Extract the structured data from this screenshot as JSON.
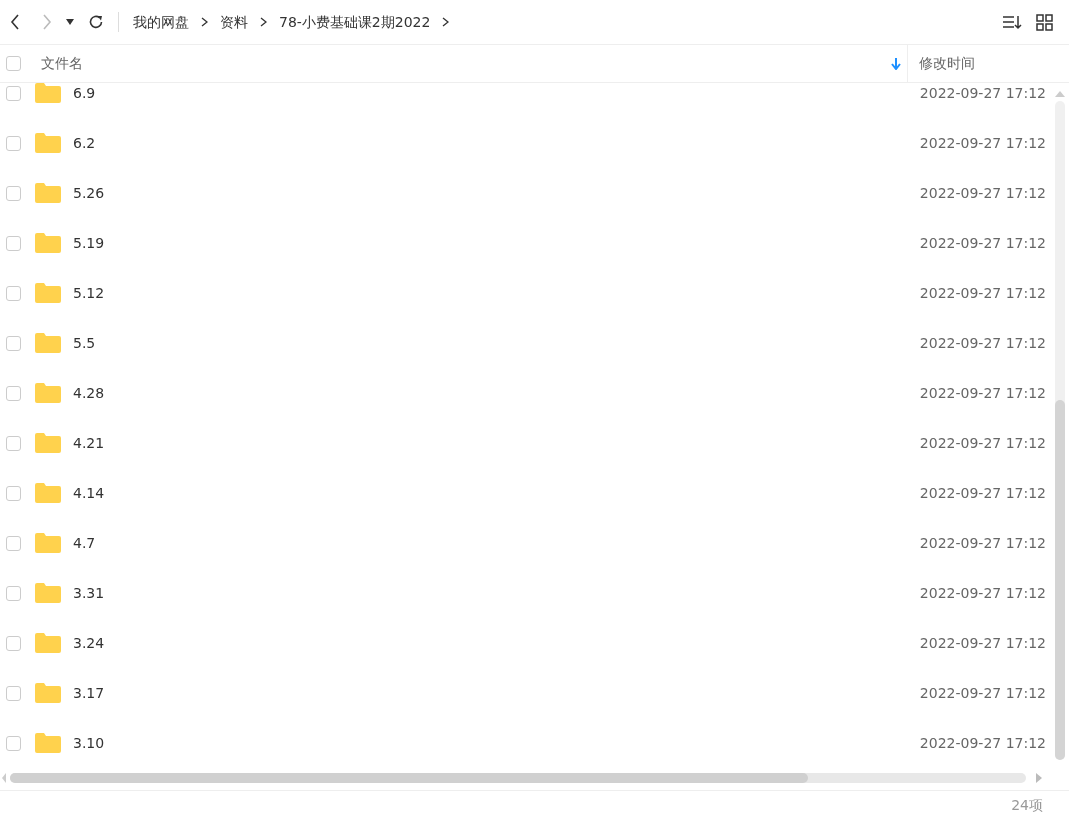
{
  "breadcrumb": [
    "我的网盘",
    "资料",
    "78-小费基础课2期2022"
  ],
  "header": {
    "checked": false,
    "columns": [
      "文件名",
      "修改时间"
    ]
  },
  "rows": [
    {
      "name": "6.9",
      "modified": "2022-09-27 17:12",
      "checked": false
    },
    {
      "name": "6.2",
      "modified": "2022-09-27 17:12",
      "checked": false
    },
    {
      "name": "5.26",
      "modified": "2022-09-27 17:12",
      "checked": false
    },
    {
      "name": "5.19",
      "modified": "2022-09-27 17:12",
      "checked": false
    },
    {
      "name": "5.12",
      "modified": "2022-09-27 17:12",
      "checked": false
    },
    {
      "name": "5.5",
      "modified": "2022-09-27 17:12",
      "checked": false
    },
    {
      "name": "4.28",
      "modified": "2022-09-27 17:12",
      "checked": false
    },
    {
      "name": "4.21",
      "modified": "2022-09-27 17:12",
      "checked": false
    },
    {
      "name": "4.14",
      "modified": "2022-09-27 17:12",
      "checked": false
    },
    {
      "name": "4.7",
      "modified": "2022-09-27 17:12",
      "checked": false
    },
    {
      "name": "3.31",
      "modified": "2022-09-27 17:12",
      "checked": false
    },
    {
      "name": "3.24",
      "modified": "2022-09-27 17:12",
      "checked": false
    },
    {
      "name": "3.17",
      "modified": "2022-09-27 17:12",
      "checked": false
    },
    {
      "name": "3.10",
      "modified": "2022-09-27 17:12",
      "checked": false
    }
  ],
  "status_bar": {
    "count": "24项"
  }
}
